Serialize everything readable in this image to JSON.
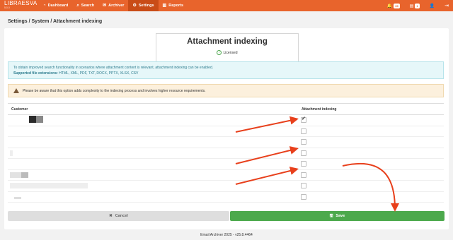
{
  "app": {
    "brand_name": "LIBRAESVA",
    "brand_version": "5.0.0"
  },
  "nav": {
    "items": [
      {
        "label": "Dashboard",
        "icon": "dashboard-icon",
        "glyph": "◔"
      },
      {
        "label": "Search",
        "icon": "search-icon",
        "glyph": "⌕"
      },
      {
        "label": "Archiver",
        "icon": "archive-icon",
        "glyph": "✉"
      },
      {
        "label": "Settings",
        "icon": "settings-icon",
        "glyph": "⚙"
      },
      {
        "label": "Reports",
        "icon": "reports-icon",
        "glyph": "▥"
      }
    ],
    "active": "Settings"
  },
  "topbar": {
    "notifications_badge": "39",
    "tasks_badge": "1",
    "bell_glyph": "🔔",
    "tasks_glyph": "▤",
    "user_glyph": "👤",
    "logout_glyph": "⇥"
  },
  "breadcrumb": {
    "items": [
      "Settings",
      "System",
      "Attachment indexing"
    ]
  },
  "header": {
    "title": "Attachment indexing",
    "status": "Licensed"
  },
  "info": {
    "text": "To obtain improved search functionality in scenarios where attachment content is relevant, attachment indexing can be enabled.",
    "extensions_label": "Supported file extensions:",
    "extensions": "HTML, XML, PDF, TXT, DOCX, PPTX, XLSX, CSV"
  },
  "warning": {
    "text": "Please be aware that this option adds complexity to the indexing process and involves higher resource requirements."
  },
  "table": {
    "columns": [
      "Customer",
      "Attachment indexing"
    ],
    "rows": [
      {
        "checked": true
      },
      {
        "checked": false
      },
      {
        "checked": false
      },
      {
        "checked": false
      },
      {
        "checked": false
      },
      {
        "checked": false
      },
      {
        "checked": false
      },
      {
        "checked": false
      }
    ]
  },
  "actions": {
    "cancel_label": "Cancel",
    "save_label": "Save"
  },
  "footer": {
    "text": "Email Archiver 2025 - v25.8.4464"
  },
  "colors": {
    "topbar": "#e8642c",
    "accent_save": "#4ca94c",
    "annotation_arrow": "#e8401c"
  }
}
